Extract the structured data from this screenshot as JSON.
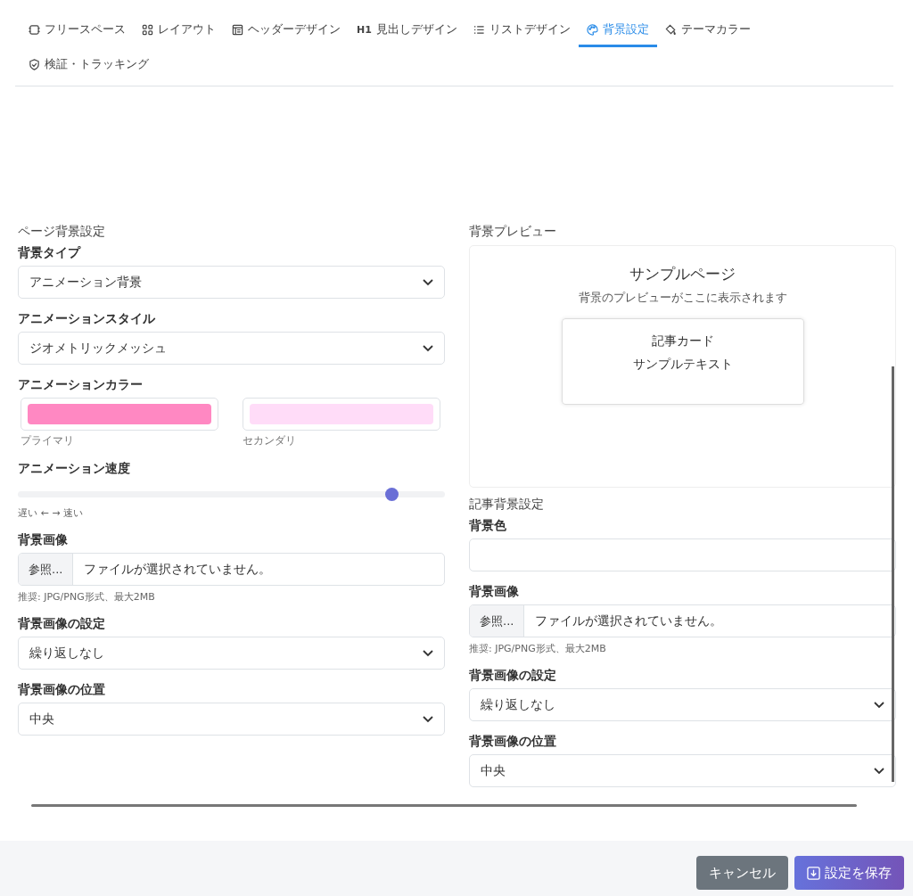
{
  "tabs": [
    {
      "label": "フリースペース",
      "selected": false
    },
    {
      "label": "レイアウト",
      "selected": false
    },
    {
      "label": "ヘッダーデザイン",
      "selected": false
    },
    {
      "prefix": "H1",
      "label": "見出しデザイン",
      "selected": false
    },
    {
      "label": "リストデザイン",
      "selected": false
    },
    {
      "label": "背景設定",
      "selected": true
    },
    {
      "label": "テーマカラー",
      "selected": false
    },
    {
      "label": "検証・トラッキング",
      "selected": false
    }
  ],
  "page_background": {
    "title": "ページ背景設定",
    "fields": [
      {
        "kind": "select",
        "label": "背景タイプ",
        "value": "アニメーション背景"
      },
      {
        "kind": "select",
        "label": "アニメーションスタイル",
        "value": "ジオメトリックメッシュ"
      },
      {
        "kind": "colors",
        "label": "アニメーションカラー",
        "colors": [
          {
            "color": "#ff88c2",
            "caption": "プライマリ"
          },
          {
            "color": "#ffdcf8",
            "caption": "セカンダリ"
          }
        ]
      },
      {
        "kind": "slider",
        "label": "アニメーション速度",
        "level": 0.875,
        "hint": "遅い ← → 速い"
      },
      {
        "kind": "file",
        "label": "背景画像",
        "button": "参照...",
        "value": "ファイルが選択されていません。",
        "hint": "推奨: JPG/PNG形式、最大2MB"
      },
      {
        "kind": "select",
        "label": "背景画像の設定",
        "value": "繰り返しなし"
      },
      {
        "kind": "select",
        "label": "背景画像の位置",
        "value": "中央"
      }
    ]
  },
  "preview": {
    "title": "背景プレビュー",
    "heading": "サンプルページ",
    "subtitle": "背景のプレビューがここに表示されます",
    "card_title": "記事カード",
    "card_text": "サンプルテキスト"
  },
  "article_background": {
    "title": "記事背景設定",
    "fields": [
      {
        "kind": "input",
        "label": "背景色"
      },
      {
        "kind": "file",
        "label": "背景画像",
        "button": "参照...",
        "value": "ファイルが選択されていません。",
        "hint": "推奨: JPG/PNG形式、最大2MB"
      },
      {
        "kind": "select",
        "label": "背景画像の設定",
        "value": "繰り返しなし"
      },
      {
        "kind": "select",
        "label": "背景画像の位置",
        "value": "中央"
      }
    ]
  },
  "buttons": {
    "cancel": "キャンセル",
    "save": "設定を保存"
  }
}
